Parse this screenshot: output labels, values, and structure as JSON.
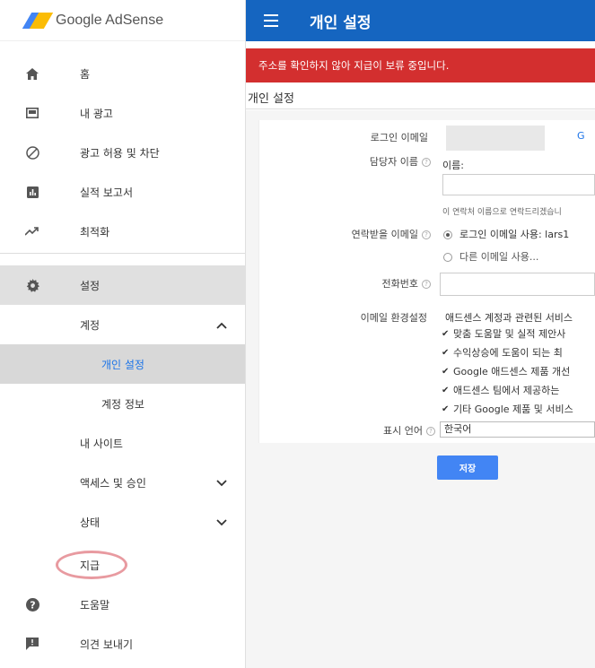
{
  "brand": {
    "name": "Google AdSense"
  },
  "sidebar": {
    "items": [
      {
        "label": "홈",
        "icon": "home-icon"
      },
      {
        "label": "내 광고",
        "icon": "ad-icon"
      },
      {
        "label": "광고 허용 및 차단",
        "icon": "block-icon"
      },
      {
        "label": "실적 보고서",
        "icon": "bar-chart-icon"
      },
      {
        "label": "최적화",
        "icon": "trending-icon"
      },
      {
        "label": "설정",
        "icon": "gear-icon"
      },
      {
        "label": "계정"
      },
      {
        "label": "개인 설정"
      },
      {
        "label": "계정 정보"
      },
      {
        "label": "내 사이트"
      },
      {
        "label": "액세스 및 승인"
      },
      {
        "label": "상태"
      },
      {
        "label": "지급"
      },
      {
        "label": "도움말",
        "icon": "help-icon"
      },
      {
        "label": "의견 보내기",
        "icon": "feedback-icon"
      }
    ]
  },
  "topbar": {
    "title": "개인 설정"
  },
  "alert": {
    "text": "주소를 확인하지 않아 지급이 보류 중입니다."
  },
  "subheader": {
    "title": "개인 설정"
  },
  "form": {
    "login_email_label": "로그인 이메일",
    "login_email_link": "G",
    "contact_name_label": "담당자 이름",
    "name_field_label": "이름:",
    "name_hint": "이 연락처 이름으로 연락드리겠습니",
    "contact_email_label": "연락받을 이메일",
    "radio_login_email": "로그인 이메일 사용: lars1",
    "radio_other_email": "다른 이메일 사용...",
    "phone_label": "전화번호",
    "email_prefs_label": "이메일 환경설정",
    "email_prefs_intro": "애드센스 계정과 관련된 서비스",
    "prefs": [
      "맞춤 도움말 및 실적 제안사",
      "수익상승에 도움이 되는 최",
      "Google 애드센스 제품 개선",
      "애드센스 팀에서 제공하는 ",
      "기타 Google 제품 및 서비스"
    ],
    "language_label": "표시 언어",
    "language_value": "한국어",
    "save_label": "저장"
  }
}
